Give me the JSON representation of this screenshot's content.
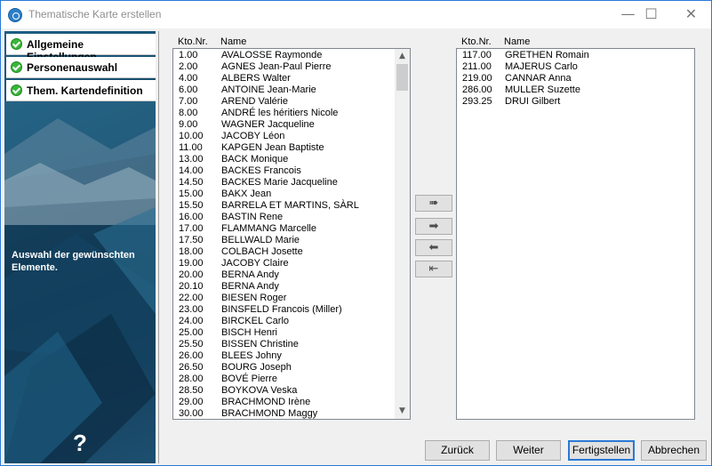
{
  "window": {
    "title": "Thematische Karte erstellen",
    "minimize_glyph": "—",
    "maximize_glyph": "☐",
    "close_glyph": "✕"
  },
  "sidebar": {
    "items": [
      {
        "label": "Allgemeine Einstellungen",
        "icon": "check-circle-icon"
      },
      {
        "label": "Personenauswahl",
        "icon": "check-circle-icon"
      },
      {
        "label": "Them. Kartendefinition",
        "icon": "check-circle-icon"
      }
    ],
    "instruction": "Auswahl der gewünschten Elemente.",
    "help_glyph": "?"
  },
  "left_list": {
    "header_nr": "Kto.Nr.",
    "header_name": "Name",
    "rows": [
      {
        "nr": "1.00",
        "name": "AVALOSSE Raymonde"
      },
      {
        "nr": "2.00",
        "name": "AGNES Jean-Paul Pierre"
      },
      {
        "nr": "4.00",
        "name": "ALBERS Walter"
      },
      {
        "nr": "6.00",
        "name": "ANTOINE Jean-Marie"
      },
      {
        "nr": "7.00",
        "name": "AREND Valérie"
      },
      {
        "nr": "8.00",
        "name": "ANDRÉ les héritiers Nicole"
      },
      {
        "nr": "9.00",
        "name": "WAGNER Jacqueline"
      },
      {
        "nr": "10.00",
        "name": "JACOBY Léon"
      },
      {
        "nr": "11.00",
        "name": "KAPGEN Jean Baptiste"
      },
      {
        "nr": "13.00",
        "name": "BACK Monique"
      },
      {
        "nr": "14.00",
        "name": "BACKES Francois"
      },
      {
        "nr": "14.50",
        "name": "BACKES Marie Jacqueline"
      },
      {
        "nr": "15.00",
        "name": "BAKX Jean"
      },
      {
        "nr": "15.50",
        "name": "BARRELA ET MARTINS, SÀRL"
      },
      {
        "nr": "16.00",
        "name": "BASTIN Rene"
      },
      {
        "nr": "17.00",
        "name": "FLAMMANG Marcelle"
      },
      {
        "nr": "17.50",
        "name": "BELLWALD Marie"
      },
      {
        "nr": "18.00",
        "name": "COLBACH Josette"
      },
      {
        "nr": "19.00",
        "name": "JACOBY Claire"
      },
      {
        "nr": "20.00",
        "name": "BERNA Andy"
      },
      {
        "nr": "20.10",
        "name": "BERNA Andy"
      },
      {
        "nr": "22.00",
        "name": "BIESEN Roger"
      },
      {
        "nr": "23.00",
        "name": "BINSFELD Francois (Miller)"
      },
      {
        "nr": "24.00",
        "name": "BIRCKEL Carlo"
      },
      {
        "nr": "25.00",
        "name": "BISCH Henri"
      },
      {
        "nr": "25.50",
        "name": "BISSEN Christine"
      },
      {
        "nr": "26.00",
        "name": "BLEES Johny"
      },
      {
        "nr": "26.50",
        "name": "BOURG Joseph"
      },
      {
        "nr": "28.00",
        "name": "BOVÉ Pierre"
      },
      {
        "nr": "28.50",
        "name": "BOYKOVA Veska"
      },
      {
        "nr": "29.00",
        "name": "BRACHMOND Irène"
      },
      {
        "nr": "30.00",
        "name": "BRACHMOND Maggy"
      }
    ]
  },
  "right_list": {
    "header_nr": "Kto.Nr.",
    "header_name": "Name",
    "rows": [
      {
        "nr": "117.00",
        "name": "GRETHEN Romain"
      },
      {
        "nr": "211.00",
        "name": "MAJERUS Carlo"
      },
      {
        "nr": "219.00",
        "name": "CANNAR Anna"
      },
      {
        "nr": "286.00",
        "name": "MULLER Suzette"
      },
      {
        "nr": "293.25",
        "name": "DRUI Gilbert"
      }
    ]
  },
  "transfer": [
    {
      "glyph": "➠",
      "icon": "move-all-right-icon"
    },
    {
      "glyph": "➡",
      "icon": "move-right-icon"
    },
    {
      "glyph": "⬅",
      "icon": "move-left-icon"
    },
    {
      "glyph": "⇤",
      "icon": "move-all-left-icon"
    }
  ],
  "buttons": {
    "back": "Zurück",
    "next": "Weiter",
    "finish": "Fertigstellen",
    "cancel": "Abbrechen"
  },
  "colors": {
    "accent": "#2b79d6",
    "sidebar_bg": "#14425f",
    "check": "#3ab53a"
  }
}
